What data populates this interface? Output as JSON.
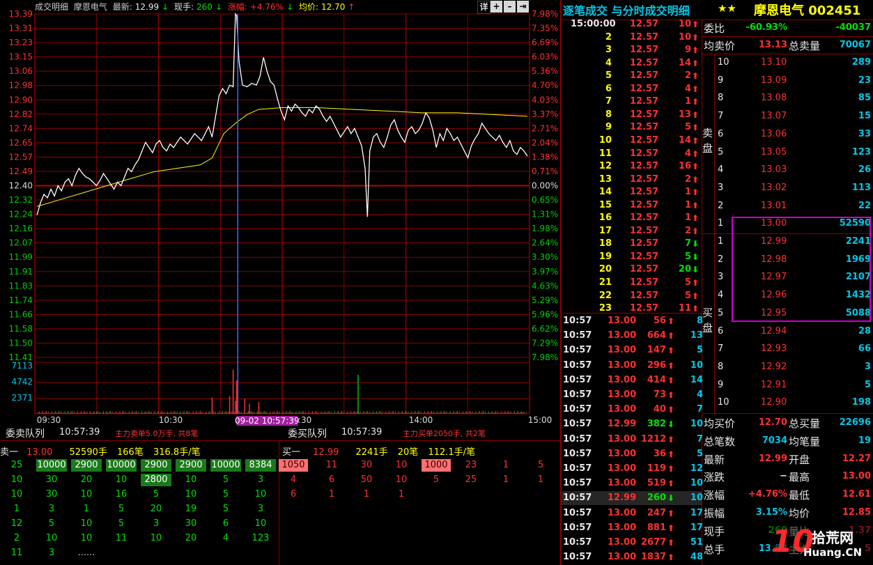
{
  "header": {
    "panel_title": "成交明细",
    "stock_name": "摩恩电气",
    "latest_label": "最新:",
    "latest_value": "12.99",
    "latest_arrow": "↓",
    "now_hand_label": "现手:",
    "now_hand_value": "260",
    "now_hand_arrow": "↓",
    "change_label": "涨幅:",
    "change_value": "+4.76%",
    "change_arrow": "↓",
    "avg_label": "均价:",
    "avg_value": "12.70",
    "avg_arrow": "↑",
    "detail_btn": "详",
    "plus_btn": "+",
    "minus_btn": "–",
    "end_btn": "⇥"
  },
  "chart_data": {
    "type": "line",
    "price_ticks": [
      "13.39",
      "13.31",
      "13.23",
      "13.15",
      "13.06",
      "12.98",
      "12.90",
      "12.82",
      "12.74",
      "12.65",
      "12.57",
      "12.49",
      "12.40",
      "12.32",
      "12.24",
      "12.16",
      "12.07",
      "11.99",
      "11.91",
      "11.83",
      "11.74",
      "11.66",
      "11.58",
      "11.50",
      "11.41"
    ],
    "pct_ticks": [
      "7.98%",
      "7.35%",
      "6.69%",
      "6.03%",
      "5.36%",
      "4.70%",
      "4.03%",
      "3.37%",
      "2.71%",
      "2.04%",
      "1.38%",
      "0.71%",
      "0.00%",
      "0.65%",
      "1.31%",
      "1.98%",
      "2.64%",
      "3.30%",
      "3.97%",
      "4.63%",
      "5.29%",
      "5.96%",
      "6.62%",
      "7.29%",
      "7.98%"
    ],
    "volume_ticks": [
      "7113",
      "4742",
      "2371"
    ],
    "time_ticks": [
      "09:30",
      "10:30",
      "11:30",
      "14:00",
      "15:00"
    ],
    "cursor_label": "09-02 10:57:39",
    "prev_close": 12.4,
    "ylim": [
      11.41,
      13.39
    ],
    "price_series": [
      [
        0,
        12.23
      ],
      [
        3,
        12.3
      ],
      [
        6,
        12.35
      ],
      [
        9,
        12.33
      ],
      [
        12,
        12.38
      ],
      [
        15,
        12.34
      ],
      [
        18,
        12.4
      ],
      [
        21,
        12.37
      ],
      [
        24,
        12.42
      ],
      [
        27,
        12.44
      ],
      [
        30,
        12.4
      ],
      [
        33,
        12.46
      ],
      [
        36,
        12.5
      ],
      [
        39,
        12.47
      ],
      [
        42,
        12.45
      ],
      [
        45,
        12.44
      ],
      [
        48,
        12.42
      ],
      [
        51,
        12.4
      ],
      [
        54,
        12.43
      ],
      [
        57,
        12.47
      ],
      [
        60,
        12.44
      ],
      [
        63,
        12.41
      ],
      [
        66,
        12.38
      ],
      [
        69,
        12.42
      ],
      [
        72,
        12.4
      ],
      [
        75,
        12.45
      ],
      [
        78,
        12.5
      ],
      [
        81,
        12.48
      ],
      [
        84,
        12.52
      ],
      [
        87,
        12.55
      ],
      [
        90,
        12.6
      ],
      [
        93,
        12.65
      ],
      [
        96,
        12.62
      ],
      [
        99,
        12.59
      ],
      [
        102,
        12.64
      ],
      [
        105,
        12.66
      ],
      [
        108,
        12.62
      ],
      [
        111,
        12.6
      ],
      [
        114,
        12.64
      ],
      [
        117,
        12.62
      ],
      [
        120,
        12.65
      ],
      [
        123,
        12.68
      ],
      [
        126,
        12.66
      ],
      [
        129,
        12.64
      ],
      [
        132,
        12.67
      ],
      [
        135,
        12.7
      ],
      [
        138,
        12.68
      ],
      [
        141,
        12.66
      ],
      [
        144,
        12.7
      ],
      [
        147,
        12.74
      ],
      [
        150,
        12.68
      ],
      [
        153,
        12.8
      ],
      [
        156,
        12.92
      ],
      [
        159,
        12.96
      ],
      [
        162,
        12.93
      ],
      [
        165,
        12.98
      ],
      [
        168,
        12.97
      ],
      [
        170,
        13.39
      ],
      [
        171,
        13.38
      ],
      [
        173,
        13.12
      ],
      [
        176,
        12.98
      ],
      [
        180,
        12.97
      ],
      [
        184,
        12.99
      ],
      [
        188,
        12.98
      ],
      [
        191,
        13.03
      ],
      [
        194,
        13.14
      ],
      [
        197,
        13.06
      ],
      [
        200,
        13.0
      ],
      [
        203,
        12.98
      ],
      [
        206,
        12.9
      ],
      [
        209,
        12.83
      ],
      [
        212,
        12.78
      ],
      [
        215,
        12.86
      ],
      [
        218,
        12.83
      ],
      [
        221,
        12.87
      ],
      [
        224,
        12.85
      ],
      [
        227,
        12.82
      ],
      [
        230,
        12.8
      ],
      [
        233,
        12.84
      ],
      [
        236,
        12.82
      ],
      [
        239,
        12.86
      ],
      [
        242,
        12.84
      ],
      [
        245,
        12.8
      ],
      [
        248,
        12.77
      ],
      [
        251,
        12.8
      ],
      [
        254,
        12.76
      ],
      [
        257,
        12.72
      ],
      [
        260,
        12.68
      ],
      [
        263,
        12.71
      ],
      [
        266,
        12.74
      ],
      [
        269,
        12.7
      ],
      [
        272,
        12.73
      ],
      [
        275,
        12.68
      ],
      [
        278,
        12.63
      ],
      [
        281,
        12.5
      ],
      [
        283,
        12.22
      ],
      [
        285,
        12.6
      ],
      [
        288,
        12.68
      ],
      [
        291,
        12.7
      ],
      [
        294,
        12.65
      ],
      [
        297,
        12.62
      ],
      [
        300,
        12.68
      ],
      [
        303,
        12.75
      ],
      [
        306,
        12.78
      ],
      [
        309,
        12.72
      ],
      [
        312,
        12.68
      ],
      [
        315,
        12.65
      ],
      [
        318,
        12.72
      ],
      [
        321,
        12.74
      ],
      [
        324,
        12.7
      ],
      [
        327,
        12.72
      ],
      [
        330,
        12.76
      ],
      [
        333,
        12.82
      ],
      [
        336,
        12.79
      ],
      [
        339,
        12.72
      ],
      [
        342,
        12.62
      ],
      [
        345,
        12.7
      ],
      [
        348,
        12.66
      ],
      [
        351,
        12.73
      ],
      [
        354,
        12.7
      ],
      [
        357,
        12.66
      ],
      [
        360,
        12.68
      ],
      [
        363,
        12.64
      ],
      [
        366,
        12.6
      ],
      [
        369,
        12.56
      ],
      [
        372,
        12.63
      ],
      [
        375,
        12.67
      ],
      [
        378,
        12.7
      ],
      [
        381,
        12.76
      ],
      [
        384,
        12.73
      ],
      [
        387,
        12.7
      ],
      [
        390,
        12.68
      ],
      [
        393,
        12.66
      ],
      [
        396,
        12.69
      ],
      [
        399,
        12.65
      ],
      [
        402,
        12.62
      ],
      [
        405,
        12.66
      ],
      [
        408,
        12.6
      ],
      [
        411,
        12.58
      ],
      [
        414,
        12.62
      ],
      [
        417,
        12.6
      ],
      [
        420,
        12.57
      ]
    ],
    "avg_series": [
      [
        0,
        12.28
      ],
      [
        20,
        12.32
      ],
      [
        40,
        12.36
      ],
      [
        60,
        12.4
      ],
      [
        80,
        12.44
      ],
      [
        100,
        12.48
      ],
      [
        120,
        12.5
      ],
      [
        140,
        12.52
      ],
      [
        150,
        12.56
      ],
      [
        160,
        12.7
      ],
      [
        170,
        12.76
      ],
      [
        180,
        12.81
      ],
      [
        190,
        12.84
      ],
      [
        210,
        12.85
      ],
      [
        240,
        12.85
      ],
      [
        270,
        12.84
      ],
      [
        300,
        12.83
      ],
      [
        330,
        12.82
      ],
      [
        360,
        12.82
      ],
      [
        390,
        12.81
      ],
      [
        420,
        12.8
      ]
    ],
    "volume_spikes": [
      [
        170,
        2050
      ],
      [
        168,
        7000
      ],
      [
        171,
        5300
      ],
      [
        172,
        3000
      ],
      [
        275,
        6200
      ],
      [
        150,
        2600
      ],
      [
        165,
        2800
      ],
      [
        178,
        2400
      ],
      [
        182,
        1600
      ],
      [
        190,
        1900
      ]
    ]
  },
  "queues": {
    "sell_queue_label": "委卖队列",
    "sell_queue_time": "10:57:39",
    "sell_main_note": "主力卖单5.0万手, 共8笔",
    "buy_queue_label": "委买队列",
    "buy_queue_time": "10:57:39",
    "buy_main_note": "主力买单2050手, 共2笔",
    "sell_head": {
      "label": "卖一",
      "price": "13.00",
      "hands": "52590手",
      "count": "166笔",
      "avg": "316.8手/笔"
    },
    "buy_head": {
      "label": "买一",
      "price": "12.99",
      "hands": "2241手",
      "count": "20笔",
      "avg": "112.1手/笔"
    },
    "sell_rows": [
      [
        "25",
        "10000",
        "2900",
        "10000",
        "2900",
        "2900",
        "10000",
        "8384"
      ],
      [
        "10",
        "30",
        "20",
        "10",
        "2800",
        "10",
        "5",
        "3"
      ],
      [
        "10",
        "30",
        "10",
        "16",
        "5",
        "10",
        "5",
        "10"
      ],
      [
        "1",
        "3",
        "1",
        "5",
        "20",
        "19",
        "5",
        "3"
      ],
      [
        "12",
        "5",
        "10",
        "5",
        "3",
        "30",
        "6",
        "10"
      ],
      [
        "2",
        "10",
        "10",
        "11",
        "10",
        "20",
        "4",
        "123"
      ],
      [
        "11",
        "3",
        "......",
        "",
        "",
        "",
        "",
        ""
      ]
    ],
    "buy_rows": [
      [
        "1050",
        "11",
        "30",
        "10",
        "1000",
        "23",
        "1",
        "5"
      ],
      [
        "4",
        "6",
        "50",
        "10",
        "5",
        "25",
        "1",
        "1"
      ],
      [
        "6",
        "1",
        "1",
        "1",
        "",
        "",
        "",
        ""
      ]
    ]
  },
  "right": {
    "title": "逐笔成交 与分时成交明细",
    "stars": "★★",
    "stock": "摩恩电气 002451",
    "tick_first_time": "15:00:00",
    "ticks": [
      {
        "idx": "",
        "price": "12.57",
        "vol": "10",
        "dir": "up"
      },
      {
        "idx": "2",
        "price": "12.57",
        "vol": "10",
        "dir": "up"
      },
      {
        "idx": "3",
        "price": "12.57",
        "vol": "9",
        "dir": "up"
      },
      {
        "idx": "4",
        "price": "12.57",
        "vol": "14",
        "dir": "up"
      },
      {
        "idx": "5",
        "price": "12.57",
        "vol": "2",
        "dir": "up"
      },
      {
        "idx": "6",
        "price": "12.57",
        "vol": "4",
        "dir": "up"
      },
      {
        "idx": "7",
        "price": "12.57",
        "vol": "1",
        "dir": "up"
      },
      {
        "idx": "8",
        "price": "12.57",
        "vol": "13",
        "dir": "up"
      },
      {
        "idx": "9",
        "price": "12.57",
        "vol": "5",
        "dir": "up"
      },
      {
        "idx": "10",
        "price": "12.57",
        "vol": "14",
        "dir": "up"
      },
      {
        "idx": "11",
        "price": "12.57",
        "vol": "4",
        "dir": "up"
      },
      {
        "idx": "12",
        "price": "12.57",
        "vol": "16",
        "dir": "up"
      },
      {
        "idx": "13",
        "price": "12.57",
        "vol": "2",
        "dir": "up"
      },
      {
        "idx": "14",
        "price": "12.57",
        "vol": "1",
        "dir": "up"
      },
      {
        "idx": "15",
        "price": "12.57",
        "vol": "1",
        "dir": "up"
      },
      {
        "idx": "16",
        "price": "12.57",
        "vol": "1",
        "dir": "up"
      },
      {
        "idx": "17",
        "price": "12.57",
        "vol": "2",
        "dir": "up"
      },
      {
        "idx": "18",
        "price": "12.57",
        "vol": "7",
        "dir": "dn"
      },
      {
        "idx": "19",
        "price": "12.57",
        "vol": "5",
        "dir": "dn"
      },
      {
        "idx": "20",
        "price": "12.57",
        "vol": "20",
        "dir": "dn"
      },
      {
        "idx": "21",
        "price": "12.57",
        "vol": "5",
        "dir": "up"
      },
      {
        "idx": "22",
        "price": "12.57",
        "vol": "5",
        "dir": "up"
      },
      {
        "idx": "23",
        "price": "12.57",
        "vol": "11",
        "dir": "up"
      }
    ],
    "trades": [
      {
        "time": "10:57",
        "price": "13.00",
        "vol": "56",
        "dir": "up",
        "n": "8"
      },
      {
        "time": "10:57",
        "price": "13.00",
        "vol": "664",
        "dir": "up",
        "n": "13"
      },
      {
        "time": "10:57",
        "price": "13.00",
        "vol": "147",
        "dir": "up",
        "n": "5"
      },
      {
        "time": "10:57",
        "price": "13.00",
        "vol": "296",
        "dir": "up",
        "n": "10"
      },
      {
        "time": "10:57",
        "price": "13.00",
        "vol": "414",
        "dir": "up",
        "n": "14"
      },
      {
        "time": "10:57",
        "price": "13.00",
        "vol": "73",
        "dir": "up",
        "n": "4"
      },
      {
        "time": "10:57",
        "price": "13.00",
        "vol": "40",
        "dir": "up",
        "n": "7"
      },
      {
        "time": "10:57",
        "price": "12.99",
        "vol": "382",
        "dir": "dn",
        "n": "10"
      },
      {
        "time": "10:57",
        "price": "13.00",
        "vol": "1212",
        "dir": "up",
        "n": "7"
      },
      {
        "time": "10:57",
        "price": "13.00",
        "vol": "36",
        "dir": "up",
        "n": "5"
      },
      {
        "time": "10:57",
        "price": "13.00",
        "vol": "119",
        "dir": "up",
        "n": "12"
      },
      {
        "time": "10:57",
        "price": "13.00",
        "vol": "519",
        "dir": "up",
        "n": "10"
      },
      {
        "time": "10:57",
        "price": "12.99",
        "vol": "260",
        "dir": "dn",
        "n": "10"
      },
      {
        "time": "10:57",
        "price": "13.00",
        "vol": "247",
        "dir": "up",
        "n": "17"
      },
      {
        "time": "10:57",
        "price": "13.00",
        "vol": "881",
        "dir": "up",
        "n": "17"
      },
      {
        "time": "10:57",
        "price": "13.00",
        "vol": "2677",
        "dir": "up",
        "n": "51"
      },
      {
        "time": "10:57",
        "price": "13.00",
        "vol": "1837",
        "dir": "up",
        "n": "48"
      }
    ],
    "weibi_label": "委比",
    "weibi_value": "-60.93%",
    "weibi_diff": "-40037",
    "avg_sell_label": "均卖价",
    "avg_sell_value": "13.13",
    "total_sell_label": "总卖量",
    "total_sell_value": "70067",
    "sell_side_label": "卖盘",
    "buy_side_label": "买盘",
    "sells": [
      {
        "lv": "10",
        "price": "13.10",
        "vol": "289"
      },
      {
        "lv": "9",
        "price": "13.09",
        "vol": "23"
      },
      {
        "lv": "8",
        "price": "13.08",
        "vol": "85"
      },
      {
        "lv": "7",
        "price": "13.07",
        "vol": "15"
      },
      {
        "lv": "6",
        "price": "13.06",
        "vol": "33"
      },
      {
        "lv": "5",
        "price": "13.05",
        "vol": "123"
      },
      {
        "lv": "4",
        "price": "13.03",
        "vol": "26"
      },
      {
        "lv": "3",
        "price": "13.02",
        "vol": "113"
      },
      {
        "lv": "2",
        "price": "13.01",
        "vol": "22"
      },
      {
        "lv": "1",
        "price": "13.00",
        "vol": "52590"
      }
    ],
    "buys": [
      {
        "lv": "1",
        "price": "12.99",
        "vol": "2241"
      },
      {
        "lv": "2",
        "price": "12.98",
        "vol": "1969"
      },
      {
        "lv": "3",
        "price": "12.97",
        "vol": "2107"
      },
      {
        "lv": "4",
        "price": "12.96",
        "vol": "1432"
      },
      {
        "lv": "5",
        "price": "12.95",
        "vol": "5088"
      },
      {
        "lv": "6",
        "price": "12.94",
        "vol": "28"
      },
      {
        "lv": "7",
        "price": "12.93",
        "vol": "66"
      },
      {
        "lv": "8",
        "price": "12.92",
        "vol": "3"
      },
      {
        "lv": "9",
        "price": "12.91",
        "vol": "5"
      },
      {
        "lv": "10",
        "price": "12.90",
        "vol": "198"
      }
    ],
    "stats": {
      "avg_buy_label": "均买价",
      "avg_buy_value": "12.70",
      "total_buy_label": "总买量",
      "total_buy_value": "22696",
      "total_count_label": "总笔数",
      "total_count_value": "7034",
      "avg_count_label": "均笔量",
      "avg_count_value": "19",
      "latest_label": "最新",
      "latest_value": "12.99",
      "open_label": "开盘",
      "open_value": "12.27",
      "change_label": "涨跌",
      "change_value": "−",
      "high_label": "最高",
      "high_value": "13.00",
      "pct_label": "涨幅",
      "pct_value": "+4.76%",
      "low_label": "最低",
      "low_value": "12.61",
      "amp_label": "振幅",
      "amp_value": "3.15%",
      "avg_label": "均价",
      "avg_value": "12.85",
      "now_label": "现手",
      "now_value": "260",
      "ratio_label": "量比",
      "ratio_value": "1.37",
      "total_label": "总手",
      "total_value": "13.52",
      "main_label": "主力",
      "main_value": "5"
    },
    "watermark": "10 Huang.CN 拾荒网"
  },
  "colors": {
    "up": "#ff3030",
    "down": "#00e000",
    "grid": "#8b0000",
    "price_line": "#ffffff",
    "avg_line": "#ffff00",
    "cursor": "#3a6cff",
    "highlight_box": "#d000d0"
  }
}
